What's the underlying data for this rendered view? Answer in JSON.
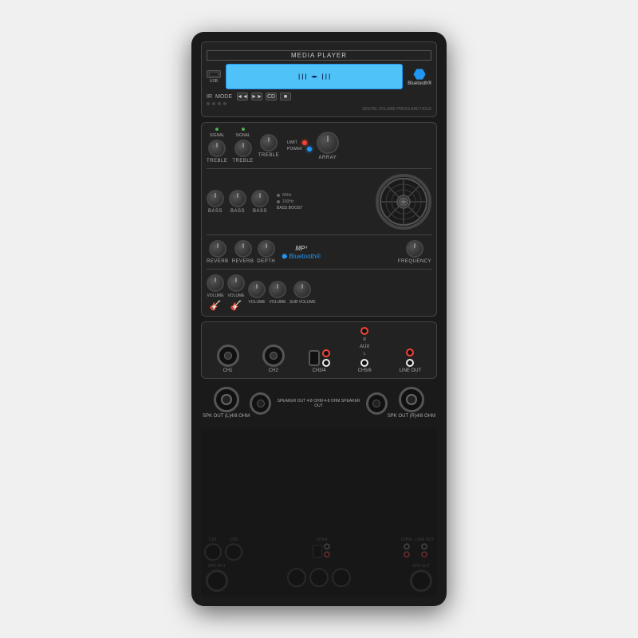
{
  "device": {
    "title": "MEDIA PLAYER",
    "bluetooth_label": "Bluetooth®",
    "usb_label": "USB",
    "lcd_text": "",
    "ir_label": "IR",
    "mode_label": "MODE",
    "digital_vol_label": "DIGITAL VOLUME PRESS AND HOLD",
    "controls": {
      "prev": "◄◄",
      "next": "►►",
      "cd": "CD",
      "stop": "■"
    },
    "channels": {
      "ch1": "CH1",
      "ch2": "CH2",
      "ch34": "CH3/4",
      "ch56": "CH5/6",
      "line_out": "LINE OUT",
      "aux": "AUX"
    },
    "knobs": {
      "signal": "SIGNAL",
      "treble": "TREBLE",
      "bass": "BASS",
      "reverb": "REVERB",
      "depth": "DEPTH",
      "volume": "VOLUME",
      "array": "ARRAY",
      "frequency": "FREQUENCY",
      "sub_volume": "SUB VOLUME",
      "bass_boost": "BASS BOOST",
      "limit": "LIMIT",
      "power": "POWER"
    },
    "freq_options": {
      "f80": "80Hz",
      "f100": "100Hz"
    },
    "mp3_label": "MP³",
    "spk_out_l": "SPK OUT\n(L)4/8 OHM",
    "spk_out_r": "SPK OUT\n(R)4/8 OHM",
    "speaker_out_detail": "SPEAKER OUT\n4-8 OHM\n4-8 OHM\nSPEAKER OUT"
  }
}
